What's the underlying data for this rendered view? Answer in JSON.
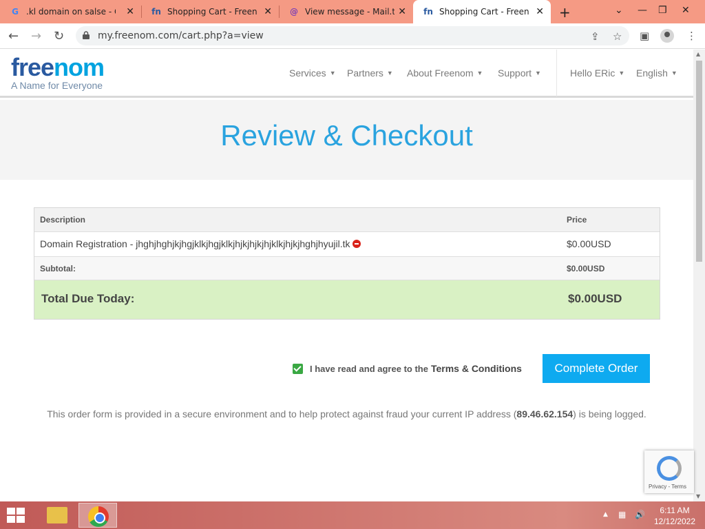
{
  "browser": {
    "tabs": [
      {
        "title": ".kl domain on salse - Goo",
        "icon": "google-icon"
      },
      {
        "title": "Shopping Cart - Freenom",
        "icon": "freenom-icon"
      },
      {
        "title": "View message - Mail.tm",
        "icon": "mailtm-icon"
      },
      {
        "title": "Shopping Cart - Freenom",
        "icon": "freenom-icon",
        "active": true
      }
    ],
    "url": "my.freenom.com/cart.php?a=view"
  },
  "site": {
    "logo_text_dark": "free",
    "logo_text_light": "nom",
    "tagline": "A Name for Everyone",
    "nav": [
      "Services",
      "Partners",
      "About Freenom",
      "Support"
    ],
    "user_greeting": "Hello ERic",
    "language": "English"
  },
  "page": {
    "title": "Review & Checkout"
  },
  "cart": {
    "headers": {
      "description": "Description",
      "price": "Price"
    },
    "items": [
      {
        "description": "Domain Registration - jhghjhghjkjhgjklkjhgjklkjhjkjhjkjhjklkjhjkjhghjhyujil.tk",
        "price": "$0.00USD"
      }
    ],
    "subtotal_label": "Subtotal:",
    "subtotal_value": "$0.00USD",
    "total_label": "Total Due Today:",
    "total_value": "$0.00USD"
  },
  "checkout": {
    "agree_text": "I have read and agree to the",
    "terms_link": "Terms & Conditions",
    "agree_checked": true,
    "complete_button": "Complete Order",
    "secure_note_prefix": "This order form is provided in a secure environment and to help protect against fraud your current IP address (",
    "ip_address": "89.46.62.154",
    "secure_note_suffix": ") is being logged."
  },
  "recaptcha": {
    "label": "Privacy - Terms"
  },
  "taskbar": {
    "time": "6:11 AM",
    "date": "12/12/2022"
  },
  "colors": {
    "accent": "#2aa3df",
    "button": "#0eaaf0",
    "total_bg": "#d9f1c4",
    "tabstrip": "#f59a84"
  }
}
